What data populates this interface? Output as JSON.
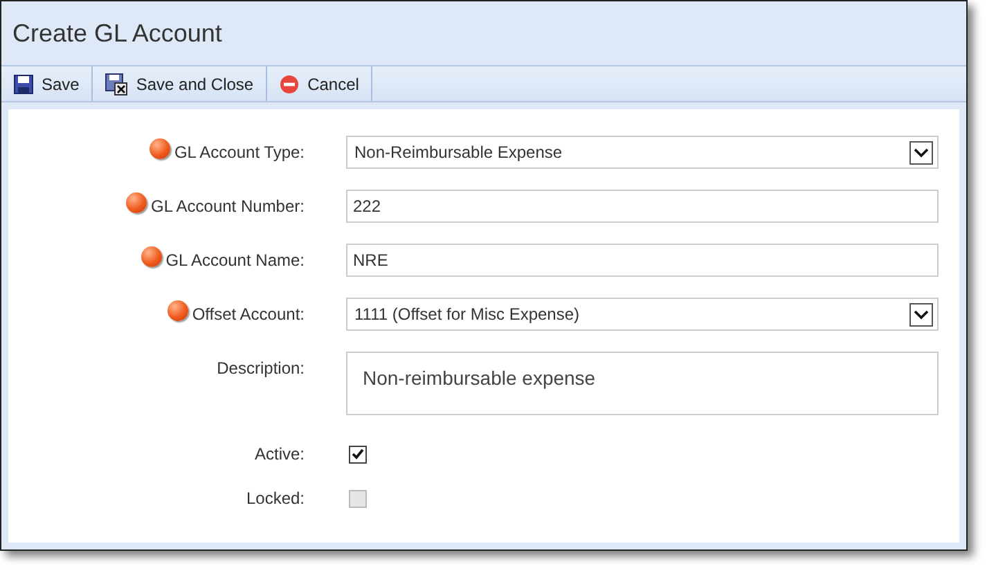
{
  "window": {
    "title": "Create GL Account"
  },
  "toolbar": [
    {
      "kind": "save",
      "label": "Save"
    },
    {
      "kind": "save_close",
      "label": "Save and Close"
    },
    {
      "kind": "cancel",
      "label": "Cancel"
    }
  ],
  "fields": [
    {
      "kind": "select",
      "label": "GL Account Type:",
      "required": true,
      "value": "Non-Reimbursable Expense"
    },
    {
      "kind": "text",
      "label": "GL Account Number:",
      "required": true,
      "value": "222"
    },
    {
      "kind": "text",
      "label": "GL Account Name:",
      "required": true,
      "value": "NRE"
    },
    {
      "kind": "select",
      "label": "Offset Account:",
      "required": true,
      "value": "1111 (Offset for Misc Expense)"
    },
    {
      "kind": "textarea",
      "label": "Description:",
      "required": false,
      "value": "Non-reimbursable expense"
    },
    {
      "kind": "checkbox",
      "label": "Active:",
      "required": false,
      "checked": true,
      "disabled": false
    },
    {
      "kind": "checkbox",
      "label": "Locked:",
      "required": false,
      "checked": false,
      "disabled": true
    }
  ]
}
